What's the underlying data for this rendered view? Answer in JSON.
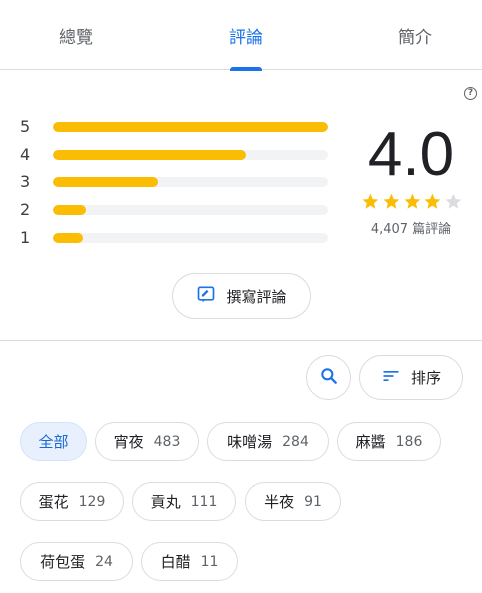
{
  "tabs": [
    {
      "label": "總覽",
      "active": false
    },
    {
      "label": "評論",
      "active": true
    },
    {
      "label": "簡介",
      "active": false
    }
  ],
  "summary": {
    "rating": "4.0",
    "stars_filled": 4,
    "stars_total": 5,
    "review_count": "4,407 篇評論"
  },
  "histogram": [
    {
      "star": "5",
      "fraction": 1.0
    },
    {
      "star": "4",
      "fraction": 0.7
    },
    {
      "star": "3",
      "fraction": 0.38
    },
    {
      "star": "2",
      "fraction": 0.12
    },
    {
      "star": "1",
      "fraction": 0.11
    }
  ],
  "actions": {
    "write_review": "撰寫評論",
    "sort": "排序"
  },
  "chips": [
    {
      "label": "全部",
      "count": "",
      "active": true
    },
    {
      "label": "宵夜",
      "count": "483"
    },
    {
      "label": "味噌湯",
      "count": "284"
    },
    {
      "label": "麻醬",
      "count": "186"
    },
    {
      "label": "蛋花",
      "count": "129"
    },
    {
      "label": "貢丸",
      "count": "111"
    },
    {
      "label": "半夜",
      "count": "91"
    },
    {
      "label": "荷包蛋",
      "count": "24"
    },
    {
      "label": "白醋",
      "count": "11"
    }
  ],
  "colors": {
    "accent": "#1a73e8",
    "star": "#fbbc04",
    "star_empty": "#dadce0",
    "bar_track": "#f1f3f4"
  }
}
